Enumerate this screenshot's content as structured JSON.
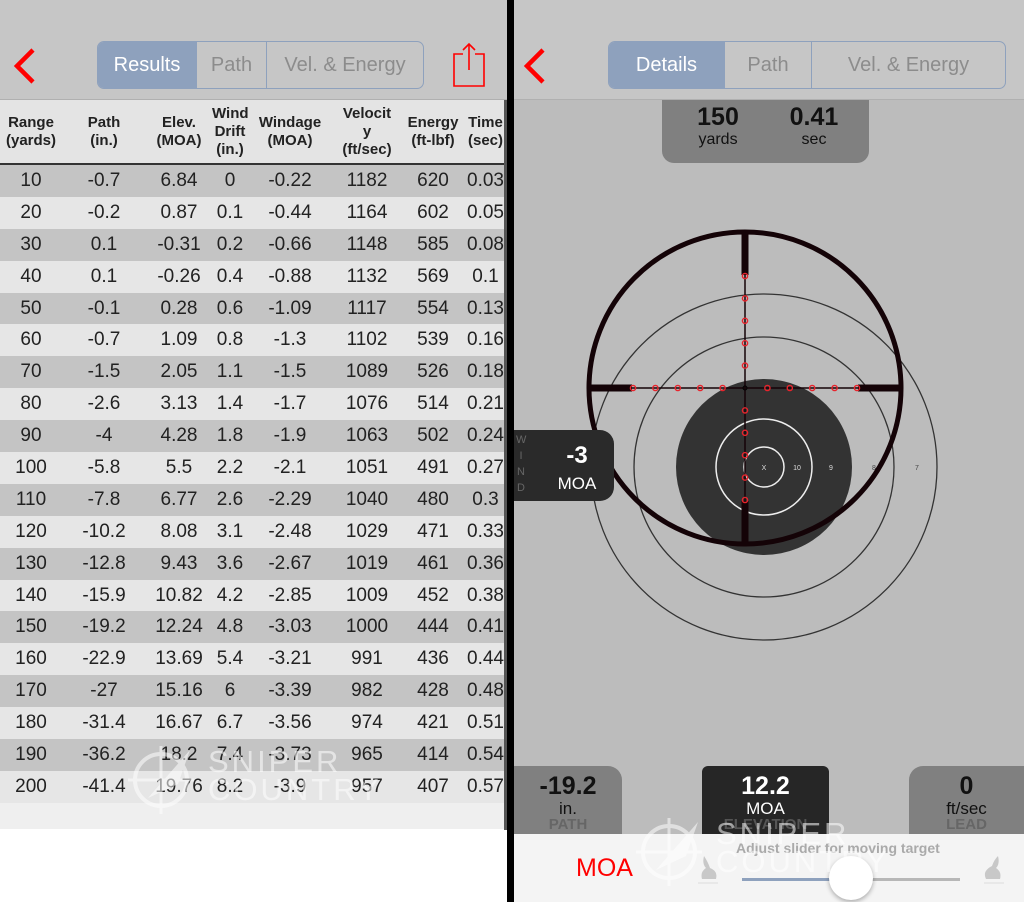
{
  "left": {
    "back_icon": "chevron-left-icon",
    "segments": [
      {
        "label": "Results",
        "active": true
      },
      {
        "label": "Path",
        "active": false
      },
      {
        "label": "Vel. & Energy",
        "active": false
      }
    ],
    "share_icon": "share-icon",
    "table": {
      "headers": [
        [
          "Range",
          "(yards)"
        ],
        [
          "Path",
          "(in.)"
        ],
        [
          "Elev.",
          "(MOA)"
        ],
        [
          "Wind",
          "Drift",
          "(in.)"
        ],
        [
          "Windage",
          "(MOA)"
        ],
        [
          "Velocit",
          "y",
          "(ft/sec)"
        ],
        [
          "Energy",
          "(ft-lbf)"
        ],
        [
          "Time",
          "(sec)"
        ]
      ],
      "rows": [
        [
          "10",
          "-0.7",
          "6.84",
          "0",
          "-0.22",
          "1182",
          "620",
          "0.03"
        ],
        [
          "20",
          "-0.2",
          "0.87",
          "0.1",
          "-0.44",
          "1164",
          "602",
          "0.05"
        ],
        [
          "30",
          "0.1",
          "-0.31",
          "0.2",
          "-0.66",
          "1148",
          "585",
          "0.08"
        ],
        [
          "40",
          "0.1",
          "-0.26",
          "0.4",
          "-0.88",
          "1132",
          "569",
          "0.1"
        ],
        [
          "50",
          "-0.1",
          "0.28",
          "0.6",
          "-1.09",
          "1117",
          "554",
          "0.13"
        ],
        [
          "60",
          "-0.7",
          "1.09",
          "0.8",
          "-1.3",
          "1102",
          "539",
          "0.16"
        ],
        [
          "70",
          "-1.5",
          "2.05",
          "1.1",
          "-1.5",
          "1089",
          "526",
          "0.18"
        ],
        [
          "80",
          "-2.6",
          "3.13",
          "1.4",
          "-1.7",
          "1076",
          "514",
          "0.21"
        ],
        [
          "90",
          "-4",
          "4.28",
          "1.8",
          "-1.9",
          "1063",
          "502",
          "0.24"
        ],
        [
          "100",
          "-5.8",
          "5.5",
          "2.2",
          "-2.1",
          "1051",
          "491",
          "0.27"
        ],
        [
          "110",
          "-7.8",
          "6.77",
          "2.6",
          "-2.29",
          "1040",
          "480",
          "0.3"
        ],
        [
          "120",
          "-10.2",
          "8.08",
          "3.1",
          "-2.48",
          "1029",
          "471",
          "0.33"
        ],
        [
          "130",
          "-12.8",
          "9.43",
          "3.6",
          "-2.67",
          "1019",
          "461",
          "0.36"
        ],
        [
          "140",
          "-15.9",
          "10.82",
          "4.2",
          "-2.85",
          "1009",
          "452",
          "0.38"
        ],
        [
          "150",
          "-19.2",
          "12.24",
          "4.8",
          "-3.03",
          "1000",
          "444",
          "0.41"
        ],
        [
          "160",
          "-22.9",
          "13.69",
          "5.4",
          "-3.21",
          "991",
          "436",
          "0.44"
        ],
        [
          "170",
          "-27",
          "15.16",
          "6",
          "-3.39",
          "982",
          "428",
          "0.48"
        ],
        [
          "180",
          "-31.4",
          "16.67",
          "6.7",
          "-3.56",
          "974",
          "421",
          "0.51"
        ],
        [
          "190",
          "-36.2",
          "18.2",
          "7.4",
          "-3.73",
          "965",
          "414",
          "0.54"
        ],
        [
          "200",
          "-41.4",
          "19.76",
          "8.2",
          "-3.9",
          "957",
          "407",
          "0.57"
        ]
      ]
    },
    "watermark": {
      "line1": "SNIPER",
      "line2": "COUNTRY"
    }
  },
  "right": {
    "back_icon": "chevron-left-icon",
    "segments": [
      {
        "label": "Details",
        "active": true
      },
      {
        "label": "Path",
        "active": false
      },
      {
        "label": "Vel. & Energy",
        "active": false
      }
    ],
    "range": {
      "value": "150",
      "unit": "yards"
    },
    "time": {
      "value": "0.41",
      "unit": "sec"
    },
    "wind": {
      "label": "WIND",
      "value": "-3",
      "unit": "MOA"
    },
    "target_ring_labels": [
      "X",
      "10",
      "9",
      "8",
      "7"
    ],
    "path": {
      "value": "-19.2",
      "unit": "in.",
      "label": "PATH"
    },
    "elevation": {
      "value": "12.2",
      "unit": "MOA",
      "label": "ELEVATION"
    },
    "lead": {
      "value": "0",
      "unit": "ft/sec",
      "label": "LEAD"
    },
    "unit_toggle": "MOA",
    "slider_hint": "Adjust slider for moving target",
    "slider_value_percent": 50,
    "watermark": {
      "line1": "SNIPER",
      "line2": "COUNTRY"
    },
    "colors": {
      "accent": "#ff0000",
      "segment": "#8ea1bd",
      "reticle": "#140307",
      "reticle_dots": "#e8242c"
    }
  }
}
